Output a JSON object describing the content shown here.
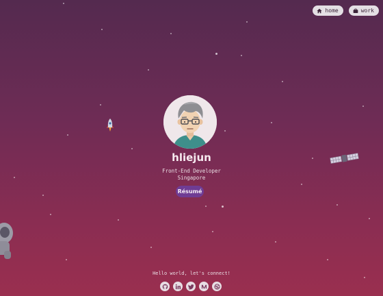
{
  "nav": {
    "items": [
      {
        "label": "home",
        "icon": "home-icon"
      },
      {
        "label": "work",
        "icon": "briefcase-icon"
      }
    ]
  },
  "profile": {
    "name": "hliejun",
    "role": "Front-End Developer",
    "location": "Singapore",
    "resume_label": "Résumé",
    "avatar_icon": "avatar-illustration"
  },
  "footer": {
    "connect_text": "Hello world, let's connect!",
    "socials": [
      {
        "icon": "github-icon"
      },
      {
        "icon": "linkedin-icon"
      },
      {
        "icon": "twitter-icon"
      },
      {
        "icon": "medium-icon"
      },
      {
        "icon": "dribbble-icon"
      }
    ]
  },
  "decorations": [
    "rocket-icon",
    "satellite-icon",
    "astronaut-icon"
  ],
  "colors": {
    "background_top": "#542a4f",
    "background_bottom": "#9a2f4f",
    "resume_button": "#6f3c94",
    "pill": "#e4dfe4"
  }
}
